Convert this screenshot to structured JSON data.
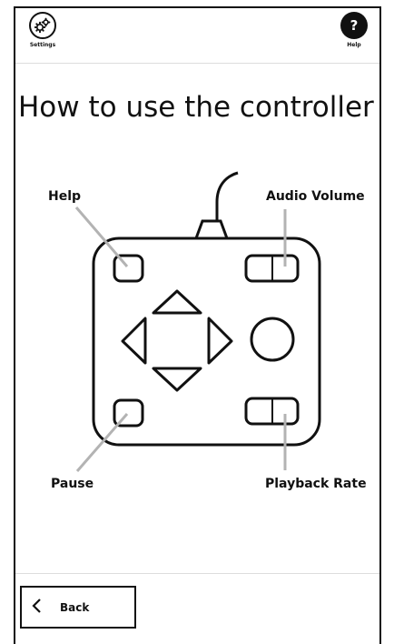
{
  "header": {
    "settings_label": "Settings",
    "help_label": "Help",
    "help_glyph": "?"
  },
  "page": {
    "title": "How to use the controller"
  },
  "controller": {
    "labels": {
      "help": "Help",
      "audio_volume": "Audio Volume",
      "pause": "Pause",
      "playback_rate": "Playback Rate"
    }
  },
  "footer": {
    "back_label": "Back",
    "back_icon": "chevron-left-icon"
  },
  "icons": {
    "settings": "gears-icon",
    "help": "question-icon"
  },
  "colors": {
    "ink": "#111111",
    "leader": "#b3b3b3",
    "divider": "#dddddd"
  }
}
